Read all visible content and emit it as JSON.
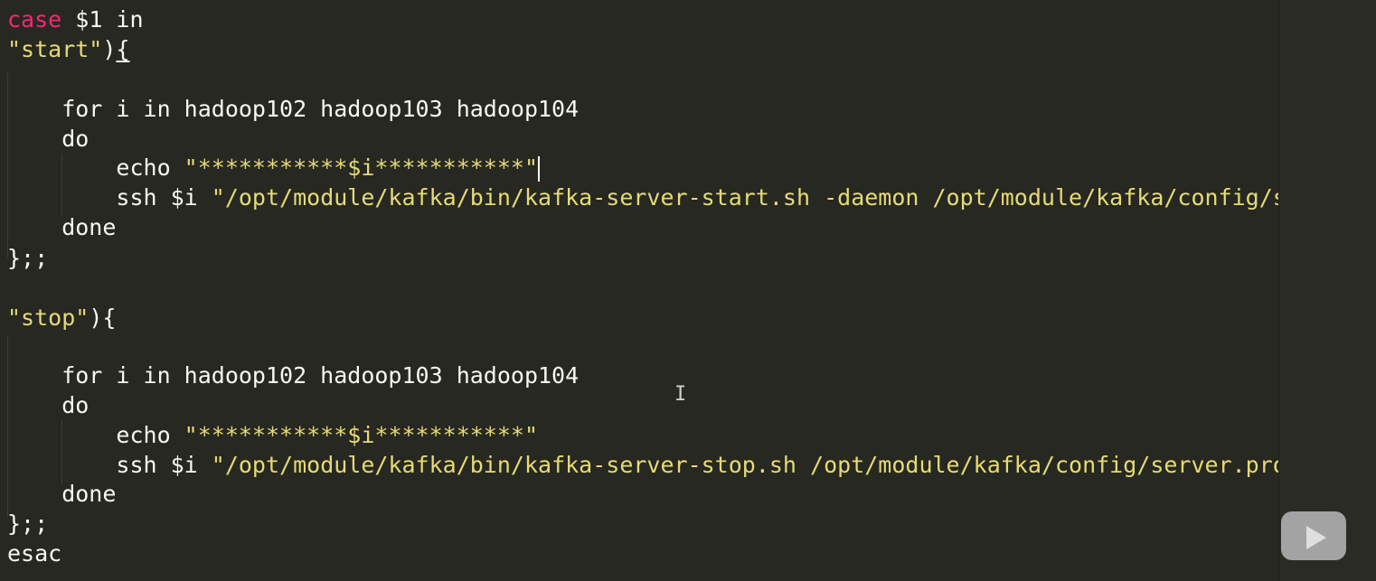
{
  "editor": {
    "lines": [
      {
        "parts": [
          {
            "t": "case",
            "c": "kw"
          },
          {
            "t": " $1 in",
            "c": "plain"
          }
        ]
      },
      {
        "parts": [
          {
            "t": "\"start\"",
            "c": "str"
          },
          {
            "t": ")",
            "c": "plain"
          },
          {
            "t": "{",
            "c": "plain"
          }
        ]
      },
      {
        "parts": []
      },
      {
        "parts": [
          {
            "t": "    for i in hadoop102 hadoop103 hadoop104",
            "c": "plain"
          }
        ]
      },
      {
        "parts": [
          {
            "t": "    do",
            "c": "plain"
          }
        ]
      },
      {
        "parts": [
          {
            "t": "        echo ",
            "c": "plain"
          },
          {
            "t": "\"***********$i***********\"",
            "c": "str"
          }
        ]
      },
      {
        "parts": [
          {
            "t": "        ssh $i ",
            "c": "plain"
          },
          {
            "t": "\"/opt/module/kafka/bin/kafka-server-start.sh -daemon /opt/module/kafka/config/server.properties\"",
            "c": "str"
          }
        ]
      },
      {
        "parts": [
          {
            "t": "    done",
            "c": "plain"
          }
        ]
      },
      {
        "parts": [
          {
            "t": "};;",
            "c": "plain"
          }
        ]
      },
      {
        "parts": []
      },
      {
        "parts": [
          {
            "t": "\"stop\"",
            "c": "str"
          },
          {
            "t": "){",
            "c": "plain"
          }
        ]
      },
      {
        "parts": []
      },
      {
        "parts": [
          {
            "t": "    for i in hadoop102 hadoop103 hadoop104",
            "c": "plain"
          }
        ]
      },
      {
        "parts": [
          {
            "t": "    do",
            "c": "plain"
          }
        ]
      },
      {
        "parts": [
          {
            "t": "        echo ",
            "c": "plain"
          },
          {
            "t": "\"***********$i***********\"",
            "c": "str"
          }
        ]
      },
      {
        "parts": [
          {
            "t": "        ssh $i ",
            "c": "plain"
          },
          {
            "t": "\"/opt/module/kafka/bin/kafka-server-stop.sh /opt/module/kafka/config/server.properties\"",
            "c": "str"
          }
        ]
      },
      {
        "parts": [
          {
            "t": "    done",
            "c": "plain"
          }
        ]
      },
      {
        "parts": [
          {
            "t": "};;",
            "c": "plain"
          }
        ]
      },
      {
        "parts": [
          {
            "t": "esac",
            "c": "plain"
          }
        ]
      }
    ]
  },
  "icons": {
    "cursor": "text-cursor-icon",
    "video_badge": "video-play-icon"
  },
  "colors": {
    "background": "#272822",
    "keyword": "#f92672",
    "string": "#e6db74",
    "text": "#f8f8f2"
  }
}
